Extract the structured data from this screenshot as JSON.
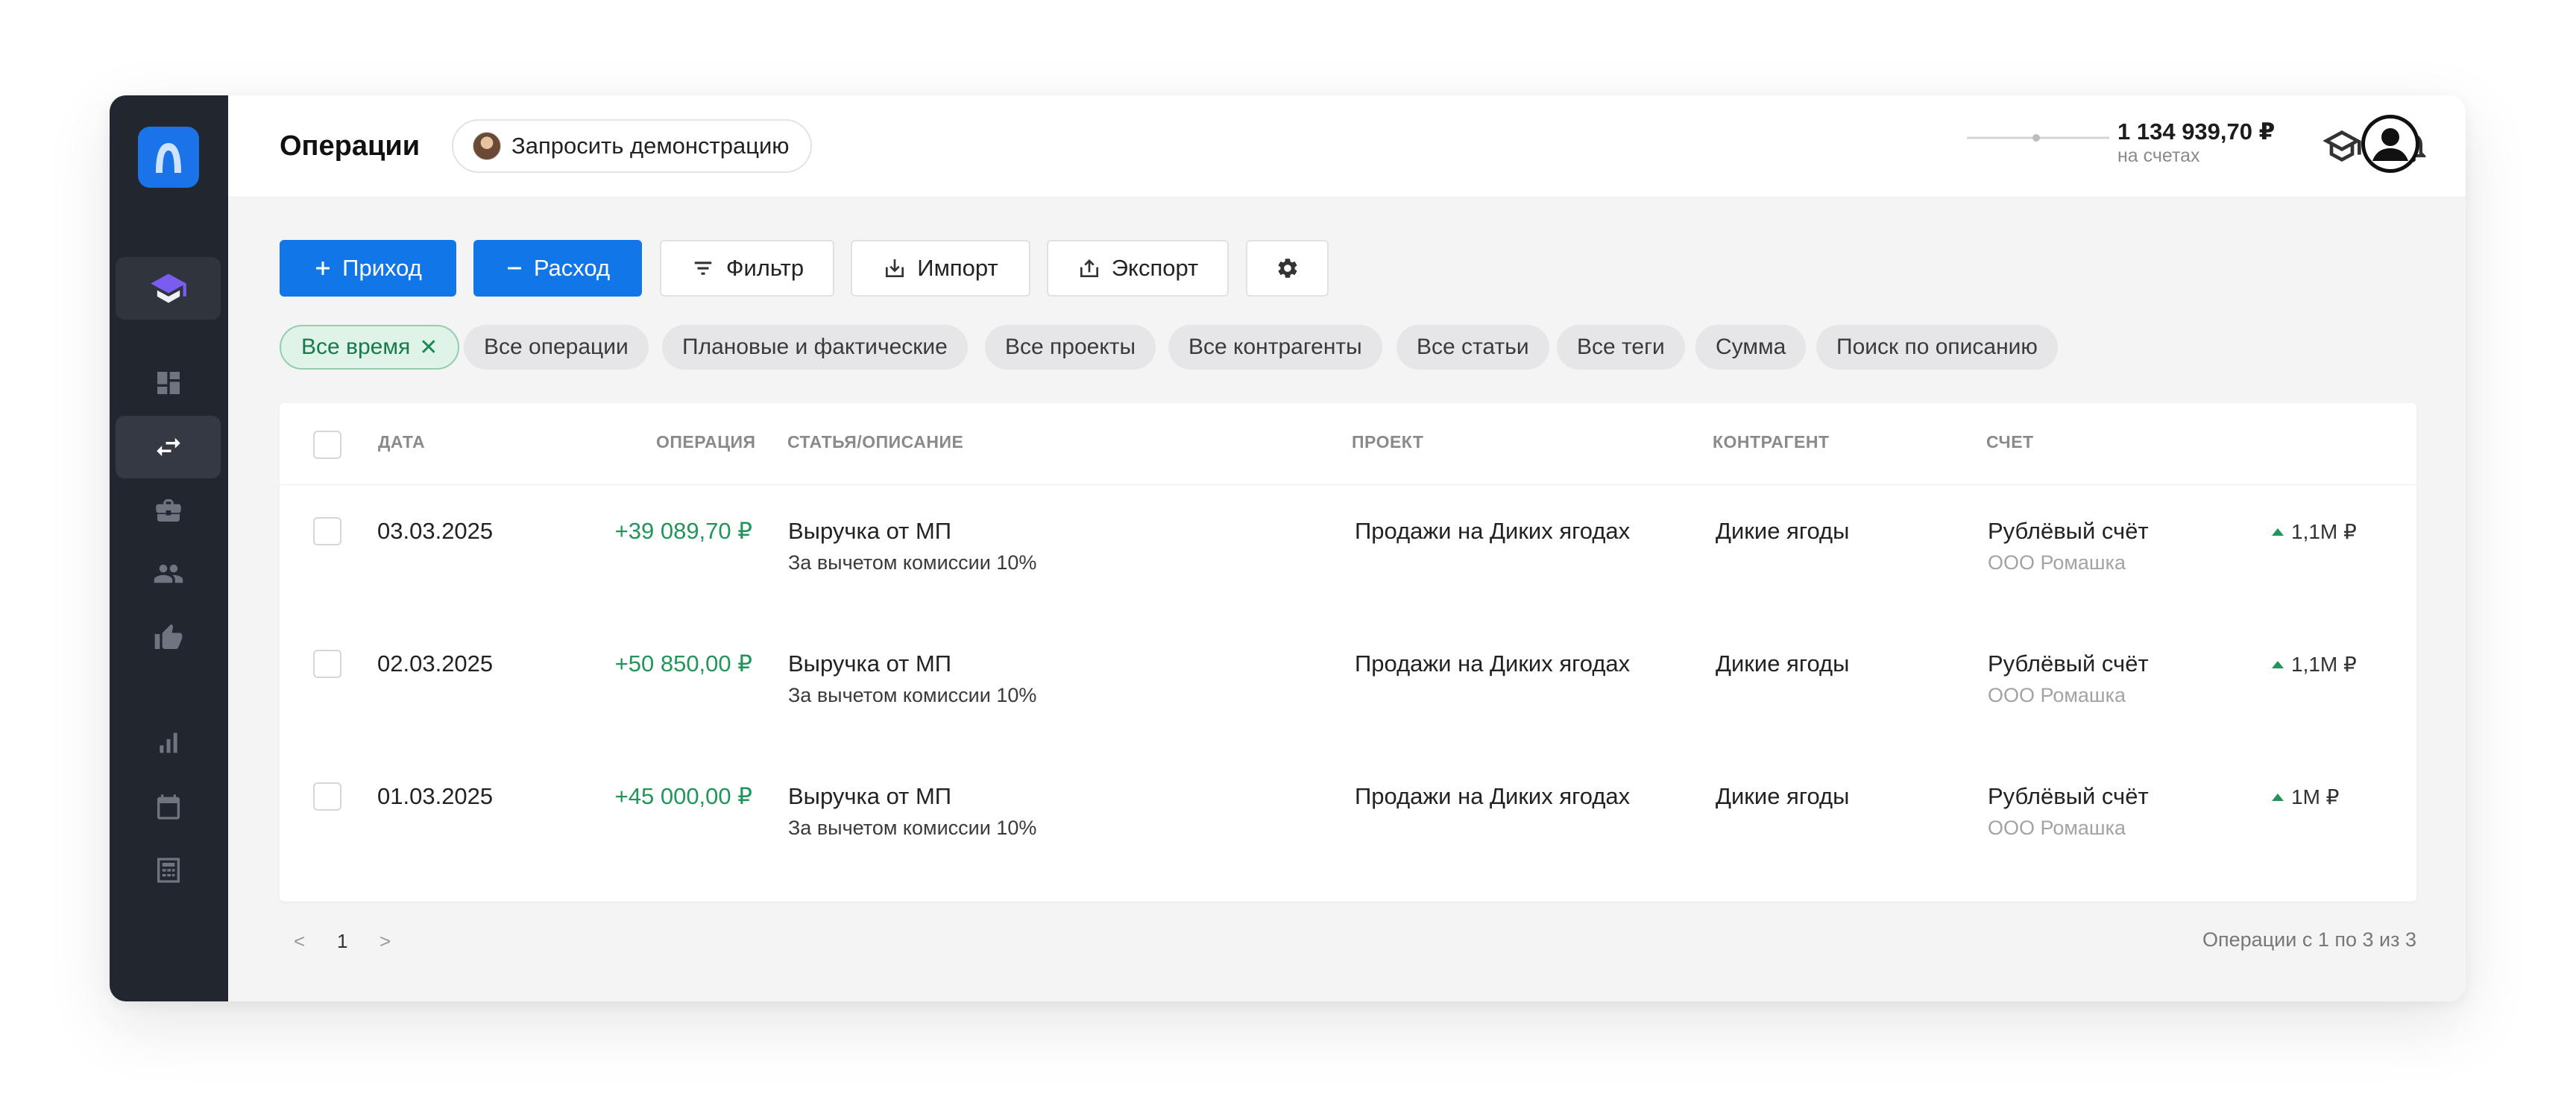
{
  "header": {
    "title": "Операции",
    "demo_label": "Запросить демонстрацию",
    "balance_amount": "1 134 939,70 ₽",
    "balance_label": "на счетах"
  },
  "sidebar": {
    "items": [
      "graduation-cap-icon",
      "dashboard-icon",
      "transfer-icon",
      "briefcase-icon",
      "people-icon",
      "thumbs-up-icon",
      "bar-chart-icon",
      "calendar-icon",
      "calculator-icon"
    ],
    "active": "transfer-icon"
  },
  "toolbar": {
    "income_label": "Приход",
    "expense_label": "Расход",
    "filter_label": "Фильтр",
    "import_label": "Импорт",
    "export_label": "Экспорт"
  },
  "filters": [
    "Все время",
    "Все операции",
    "Плановые и фактические",
    "Все проекты",
    "Все контрагенты",
    "Все статьи",
    "Все теги",
    "Сумма",
    "Поиск по описанию"
  ],
  "table": {
    "columns": [
      "ДАТА",
      "ОПЕРАЦИЯ",
      "СТАТЬЯ/ОПИСАНИЕ",
      "ПРОЕКТ",
      "КОНТРАГЕНТ",
      "СЧЕТ"
    ],
    "rows": [
      {
        "date": "03.03.2025",
        "amount": "+39 089,70 ₽",
        "article": "Выручка от МП",
        "description": "За вычетом комиссии 10%",
        "project": "Продажи на Диких ягодах",
        "counterparty": "Дикие ягоды",
        "account": "Рублёвый счёт",
        "account_balance": "1,1М ₽",
        "company": "ООО Ромашка"
      },
      {
        "date": "02.03.2025",
        "amount": "+50 850,00 ₽",
        "article": "Выручка от МП",
        "description": "За вычетом комиссии 10%",
        "project": "Продажи на Диких ягодах",
        "counterparty": "Дикие ягоды",
        "account": "Рублёвый счёт",
        "account_balance": "1,1М ₽",
        "company": "ООО Ромашка"
      },
      {
        "date": "01.03.2025",
        "amount": "+45 000,00 ₽",
        "article": "Выручка от МП",
        "description": "За вычетом комиссии 10%",
        "project": "Продажи на Диких ягодах",
        "counterparty": "Дикие ягоды",
        "account": "Рублёвый счёт",
        "account_balance": "1М ₽",
        "company": "ООО Ромашка"
      }
    ]
  },
  "pagination": {
    "prev": "<",
    "page": "1",
    "next": ">",
    "summary": "Операции с 1 по 3 из 3"
  },
  "colors": {
    "primary": "#1177e8",
    "sidebar": "#22262e",
    "income": "#22955a",
    "active_chip_bg": "#dff3e8"
  }
}
